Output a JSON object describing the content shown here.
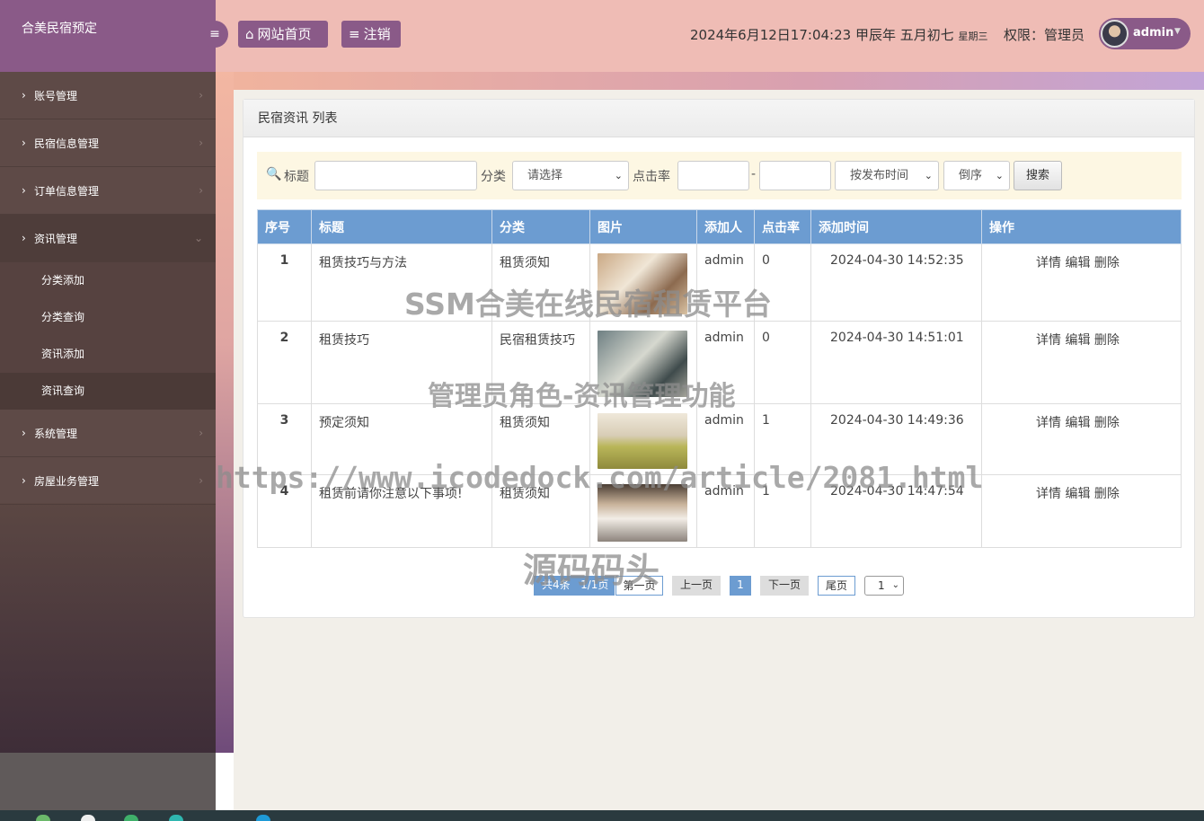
{
  "brand": {
    "title": "合美民宿预定"
  },
  "header": {
    "home_label": "网站首页",
    "logout_label": "注销",
    "datetime": "2024年6月12日17:04:23 甲辰年 五月初七",
    "weekday": "星期三",
    "permission": "权限：管理员",
    "username": "admin"
  },
  "sidebar": {
    "items": [
      {
        "label": "账号管理"
      },
      {
        "label": "民宿信息管理"
      },
      {
        "label": "订单信息管理"
      },
      {
        "label": "资讯管理"
      },
      {
        "label": "系统管理"
      },
      {
        "label": "房屋业务管理"
      }
    ],
    "subitems": [
      {
        "label": "分类添加"
      },
      {
        "label": "分类查询"
      },
      {
        "label": "资讯添加"
      },
      {
        "label": "资讯查询"
      }
    ]
  },
  "panel": {
    "title": "民宿资讯 列表"
  },
  "search": {
    "title_label": "标题",
    "category_label": "分类",
    "category_value": "请选择",
    "clicks_label": "点击率",
    "range_sep": "-",
    "sort_field": "按发布时间",
    "sort_order": "倒序",
    "button": "搜索"
  },
  "table": {
    "headers": [
      "序号",
      "标题",
      "分类",
      "图片",
      "添加人",
      "点击率",
      "添加时间",
      "操作"
    ],
    "rows": [
      {
        "no": "1",
        "title": "租赁技巧与方法",
        "category": "租赁须知",
        "user": "admin",
        "clicks": "0",
        "time": "2024-04-30 14:52:35"
      },
      {
        "no": "2",
        "title": "租赁技巧",
        "category": "民宿租赁技巧",
        "user": "admin",
        "clicks": "0",
        "time": "2024-04-30 14:51:01"
      },
      {
        "no": "3",
        "title": "预定须知",
        "category": "租赁须知",
        "user": "admin",
        "clicks": "1",
        "time": "2024-04-30 14:49:36"
      },
      {
        "no": "4",
        "title": "租赁前请你注意以下事项!",
        "category": "租赁须知",
        "user": "admin",
        "clicks": "1",
        "time": "2024-04-30 14:47:54"
      }
    ],
    "ops": {
      "detail": "详情",
      "edit": "编辑",
      "delete": "删除"
    }
  },
  "pager": {
    "total": "共4条",
    "pages": "1/1页",
    "first": "第一页",
    "prev": "上一页",
    "current": "1",
    "next": "下一页",
    "last": "尾页",
    "select_value": "1"
  },
  "watermark": {
    "line1": "SSM合美在线民宿租赁平台",
    "line2": "管理员角色-资讯管理功能",
    "line3": "https://www.icodedock.com/article/2081.html",
    "line4": "源码码头"
  },
  "colors": {
    "accent": "#8a5a88",
    "table_header": "#6c9cd1",
    "sidebar": "#5e4a47",
    "header": "#efbcb5"
  }
}
